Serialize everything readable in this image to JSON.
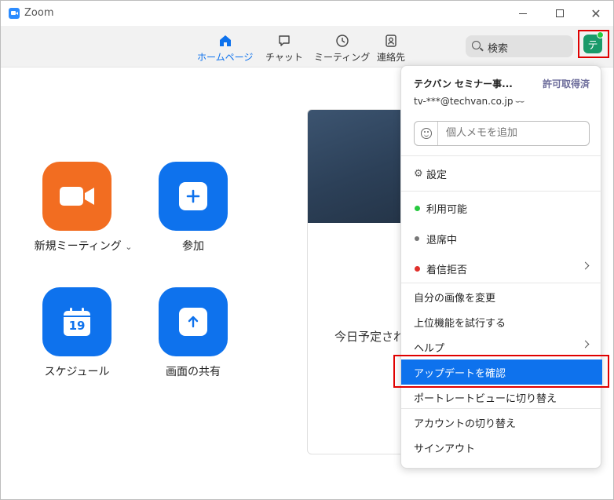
{
  "window": {
    "title": "Zoom"
  },
  "toolbar": {
    "tabs": [
      {
        "label": "ホームページ",
        "icon": "home-icon",
        "active": true
      },
      {
        "label": "チャット",
        "icon": "chat-icon",
        "active": false
      },
      {
        "label": "ミーティング",
        "icon": "clock-icon",
        "active": false
      },
      {
        "label": "連絡先",
        "icon": "contacts-icon",
        "active": false
      }
    ],
    "search_label": "検索",
    "avatar_initial": "テ"
  },
  "home": {
    "actions": [
      {
        "label": "新規ミーティング",
        "dropdown": "⌄",
        "color": "#f26d21"
      },
      {
        "label": "参加",
        "color": "#0e72ed"
      },
      {
        "label": "スケジュール",
        "calendar_day": "19",
        "color": "#0e72ed"
      },
      {
        "label": "画面の共有",
        "color": "#0e72ed"
      }
    ],
    "calendar_text": "今日予定され"
  },
  "menu": {
    "name": "テクバン セミナー事...",
    "license": "許可取得済",
    "email": "tv-***@techvan.co.jp",
    "memo_placeholder": "個人メモを追加",
    "settings": "設定",
    "status": [
      {
        "label": "利用可能",
        "color": "#27c93f"
      },
      {
        "label": "退席中",
        "color": "#777777"
      },
      {
        "label": "着信拒否",
        "color": "#e0302b"
      }
    ],
    "items": [
      "自分の画像を変更",
      "上位機能を試行する",
      "ヘルプ",
      "アップデートを確認",
      "ポートレートビューに切り替え",
      "アカウントの切り替え",
      "サインアウト"
    ],
    "selected_item": "アップデートを確認"
  },
  "colors": {
    "accent": "#0e72ed",
    "highlight_border": "#e00000"
  }
}
